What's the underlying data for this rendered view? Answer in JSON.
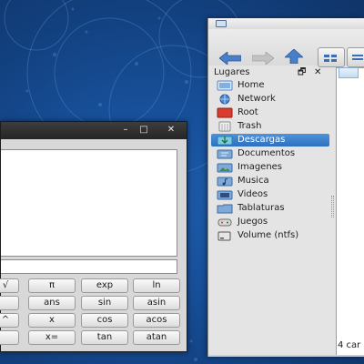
{
  "file_manager": {
    "sidebar_title": "Lugares",
    "sidebar_controls": {
      "detach": "🗗",
      "close": "✕"
    },
    "places": [
      {
        "label": "Home",
        "icon": "home-icon",
        "selected": false
      },
      {
        "label": "Network",
        "icon": "network-icon",
        "selected": false
      },
      {
        "label": "Root",
        "icon": "root-icon",
        "selected": false
      },
      {
        "label": "Trash",
        "icon": "trash-icon",
        "selected": false
      },
      {
        "label": "Descargas",
        "icon": "downloads-icon",
        "selected": true
      },
      {
        "label": "Documentos",
        "icon": "documents-icon",
        "selected": false
      },
      {
        "label": "Imagenes",
        "icon": "images-icon",
        "selected": false
      },
      {
        "label": "Musica",
        "icon": "music-icon",
        "selected": false
      },
      {
        "label": "Videos",
        "icon": "videos-icon",
        "selected": false
      },
      {
        "label": "Tablaturas",
        "icon": "folder-icon",
        "selected": false
      },
      {
        "label": "Juegos",
        "icon": "games-icon",
        "selected": false
      },
      {
        "label": "Volume (ntfs)",
        "icon": "drive-icon",
        "selected": false
      }
    ],
    "status": "4 car",
    "colors": {
      "selection": "#3a7fce",
      "toolbar_arrow": "#4a7fc8"
    }
  },
  "calculator": {
    "title_controls": {
      "minimize": "–",
      "maximize": "□",
      "close": "✕"
    },
    "display_value": "",
    "input_value": "",
    "buttons": [
      [
        "√",
        "π",
        "exp",
        "ln"
      ],
      [
        "",
        "ans",
        "sin",
        "asin"
      ],
      [
        "^",
        "x",
        "cos",
        "acos"
      ],
      [
        "",
        "x=",
        "tan",
        "atan"
      ]
    ]
  }
}
